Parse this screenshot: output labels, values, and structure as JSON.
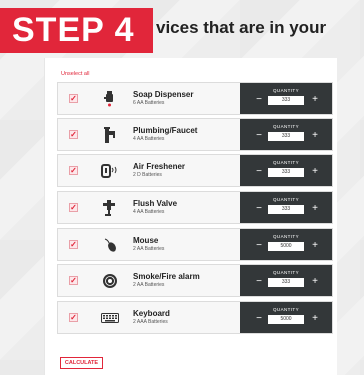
{
  "header": {
    "step_label": "STEP 4",
    "title": "vices that are in your"
  },
  "controls": {
    "unselect_all": "Unselect all",
    "calculate": "CALCULATE"
  },
  "devices": [
    {
      "name": "Soap Dispenser",
      "battery": "6 AA Batteries",
      "quantity_label": "QUANTITY",
      "quantity": "333",
      "icon": "soap-dispenser-icon"
    },
    {
      "name": "Plumbing/Faucet",
      "battery": "4 AA Batteries",
      "quantity_label": "QUANTITY",
      "quantity": "333",
      "icon": "faucet-icon"
    },
    {
      "name": "Air Freshener",
      "battery": "2 D Batteries",
      "quantity_label": "QUANTITY",
      "quantity": "333",
      "icon": "air-freshener-icon"
    },
    {
      "name": "Flush Valve",
      "battery": "4 AA Batteries",
      "quantity_label": "QUANTITY",
      "quantity": "333",
      "icon": "flush-valve-icon"
    },
    {
      "name": "Mouse",
      "battery": "2 AA Batteries",
      "quantity_label": "QUANTITY",
      "quantity": "5000",
      "icon": "mouse-icon"
    },
    {
      "name": "Smoke/Fire alarm",
      "battery": "2 AA Batteries",
      "quantity_label": "QUANTITY",
      "quantity": "333",
      "icon": "smoke-alarm-icon"
    },
    {
      "name": "Keyboard",
      "battery": "2 AAA Batteries",
      "quantity_label": "QUANTITY",
      "quantity": "5000",
      "icon": "keyboard-icon"
    }
  ],
  "theme": {
    "accent": "#e1263a",
    "quantity_panel": "#333739"
  }
}
